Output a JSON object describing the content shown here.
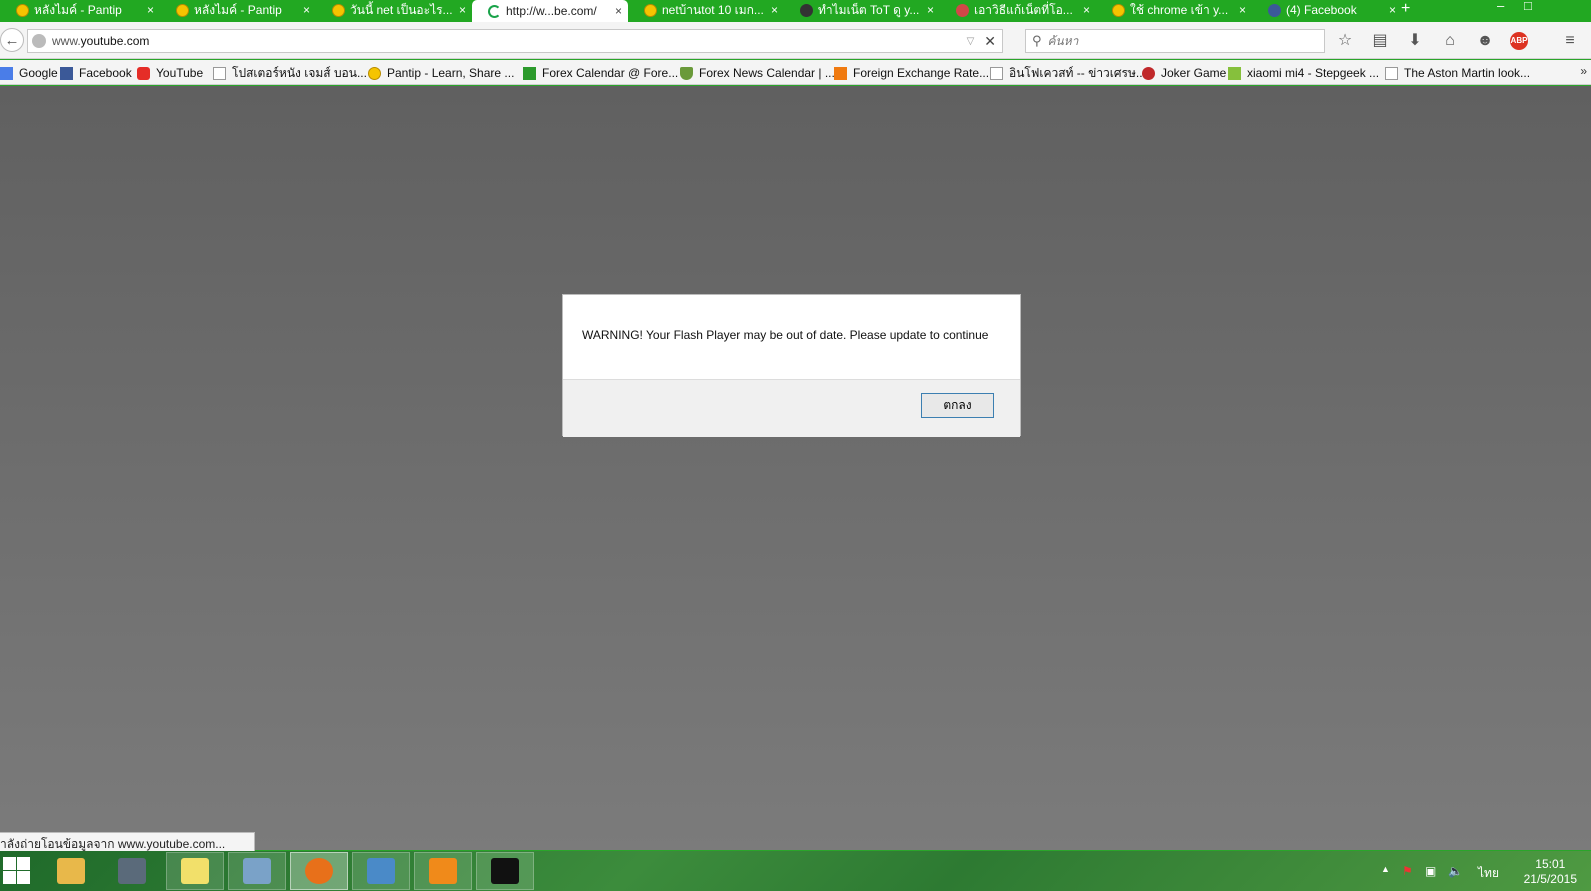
{
  "tabs": [
    {
      "label": "หลังไมค์ - Pantip",
      "favicon": "smiley-icon",
      "active": false
    },
    {
      "label": "หลังไมค์ - Pantip",
      "favicon": "smiley-icon",
      "active": false
    },
    {
      "label": "วันนี้ net เป็นอะไร...",
      "favicon": "smiley-icon",
      "active": false
    },
    {
      "label": "http://w...be.com/",
      "favicon": "loading-icon",
      "active": true
    },
    {
      "label": "netบ้านtot 10 เมก...",
      "favicon": "smiley-icon",
      "active": false
    },
    {
      "label": "ทำไมเน็ต ToT ดู y...",
      "favicon": "diamond-icon",
      "active": false
    },
    {
      "label": "เอาวิธีแก้เน็ตที่โอ...",
      "favicon": "image-icon",
      "active": false
    },
    {
      "label": "ใช้ chrome เข้า y...",
      "favicon": "smiley-icon",
      "active": false
    },
    {
      "label": "(4) Facebook",
      "favicon": "facebook-icon",
      "active": false
    }
  ],
  "tab_close_glyph": "×",
  "new_tab_glyph": "+",
  "window_controls": {
    "minimize": "–",
    "maximize": "□"
  },
  "navbar": {
    "back_glyph": "←",
    "url_prefix": "www.",
    "url_domain": "youtube.com",
    "dropdown_glyph": "▽",
    "stop_glyph": "✕",
    "search_placeholder": "ค้นหา",
    "search_glyph": "⚲",
    "toolbar_icons": [
      "☆",
      "▤",
      "⬇",
      "⌂",
      "☻"
    ],
    "abp_label": "ABP",
    "menu_glyph": "≡"
  },
  "bookmarks": [
    {
      "label": "Google",
      "icon": "ic-g"
    },
    {
      "label": "Facebook",
      "icon": "ic-fb"
    },
    {
      "label": "YouTube",
      "icon": "ic-yt"
    },
    {
      "label": "โปสเตอร์หนัง เจมส์ บอน...",
      "icon": "ic-blank"
    },
    {
      "label": "Pantip - Learn, Share ...",
      "icon": "ic-smile"
    },
    {
      "label": "Forex Calendar @ Fore...",
      "icon": "ic-green"
    },
    {
      "label": "Forex News Calendar | ...",
      "icon": "ic-shield"
    },
    {
      "label": "Foreign Exchange Rate...",
      "icon": "ic-orange"
    },
    {
      "label": "อินโฟเควสท์ -- ข่าวเศรษ...",
      "icon": "ic-blank"
    },
    {
      "label": "Joker Game",
      "icon": "ic-joker"
    },
    {
      "label": "xiaomi mi4 - Stepgeek ...",
      "icon": "ic-lime"
    },
    {
      "label": "The Aston Martin look...",
      "icon": "ic-blank"
    }
  ],
  "bookmarks_more": "»",
  "dialog": {
    "message": "WARNING! Your Flash Player may be out of date. Please update to continue",
    "ok_label": "ตกลง"
  },
  "status": {
    "text": "ำลังถ่ายโอนข้อมูลจาก www.youtube.com..."
  },
  "taskbar": {
    "apps": [
      {
        "name": "file-explorer",
        "color": "#e8b84a"
      },
      {
        "name": "computer",
        "color": "#5a6a7a"
      },
      {
        "name": "sticky-notes",
        "color": "#f2e06a"
      },
      {
        "name": "user-manager",
        "color": "#7aa2c8"
      },
      {
        "name": "firefox",
        "color": "#e8701a"
      },
      {
        "name": "remote-desktop",
        "color": "#4a8ac8"
      },
      {
        "name": "media-player",
        "color": "#f08a1a"
      },
      {
        "name": "command-prompt",
        "color": "#111111"
      }
    ],
    "tray": {
      "chevron": "▲",
      "language": "ไทย",
      "time": "15:01",
      "date": "21/5/2015"
    }
  }
}
